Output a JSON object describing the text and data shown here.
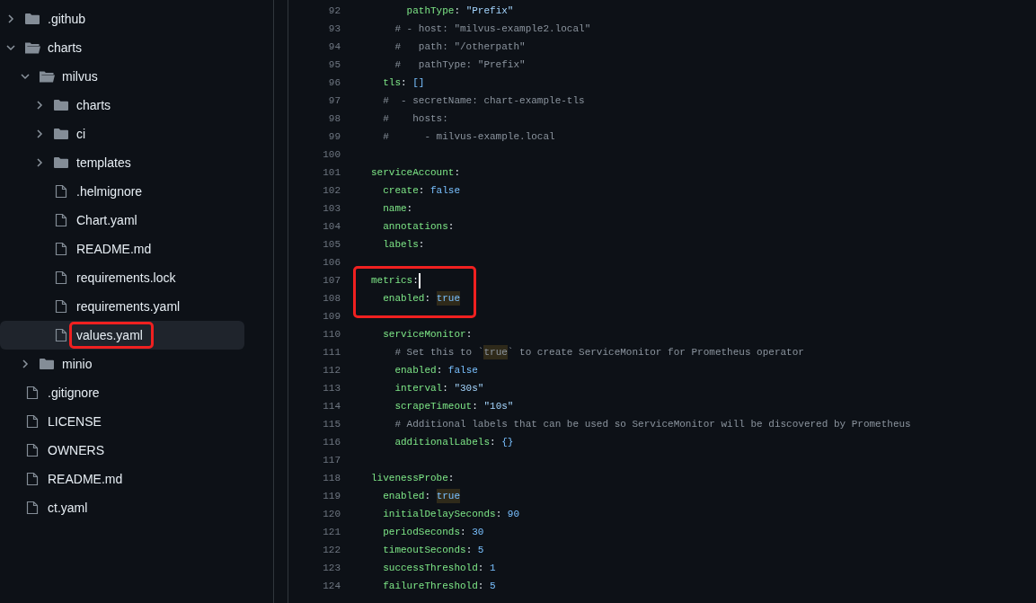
{
  "file_tree": [
    {
      "kind": "folder",
      "label": ".github",
      "expanded": false,
      "selected": false,
      "marked": false
    },
    {
      "kind": "folder",
      "label": "charts",
      "expanded": true,
      "selected": false,
      "marked": false,
      "children": [
        {
          "kind": "folder",
          "label": "milvus",
          "expanded": true,
          "selected": false,
          "marked": false,
          "children": [
            {
              "kind": "folder",
              "label": "charts",
              "expanded": false,
              "selected": false,
              "marked": false
            },
            {
              "kind": "folder",
              "label": "ci",
              "expanded": false,
              "selected": false,
              "marked": false
            },
            {
              "kind": "folder",
              "label": "templates",
              "expanded": false,
              "selected": false,
              "marked": false
            },
            {
              "kind": "file",
              "label": ".helmignore",
              "selected": false,
              "marked": false
            },
            {
              "kind": "file",
              "label": "Chart.yaml",
              "selected": false,
              "marked": false
            },
            {
              "kind": "file",
              "label": "README.md",
              "selected": false,
              "marked": false
            },
            {
              "kind": "file",
              "label": "requirements.lock",
              "selected": false,
              "marked": false
            },
            {
              "kind": "file",
              "label": "requirements.yaml",
              "selected": false,
              "marked": false
            },
            {
              "kind": "file",
              "label": "values.yaml",
              "selected": true,
              "marked": true
            }
          ]
        },
        {
          "kind": "folder",
          "label": "minio",
          "expanded": false,
          "selected": false,
          "marked": false
        }
      ]
    },
    {
      "kind": "file",
      "label": ".gitignore",
      "selected": false,
      "marked": false
    },
    {
      "kind": "file",
      "label": "LICENSE",
      "selected": false,
      "marked": false
    },
    {
      "kind": "file",
      "label": "OWNERS",
      "selected": false,
      "marked": false
    },
    {
      "kind": "file",
      "label": "README.md",
      "selected": false,
      "marked": false
    },
    {
      "kind": "file",
      "label": "ct.yaml",
      "selected": false,
      "marked": false
    }
  ],
  "code": {
    "lines": [
      {
        "n": "92",
        "marked": false,
        "cursor": false,
        "tokens": [
          {
            "kind": "key",
            "text": "      pathType"
          },
          {
            "kind": "punct",
            "text": ": "
          },
          {
            "kind": "str",
            "text": "\"Prefix\""
          }
        ]
      },
      {
        "n": "93",
        "marked": false,
        "cursor": false,
        "tokens": [
          {
            "kind": "comment",
            "text": "    # - host: \"milvus-example2.local\""
          }
        ]
      },
      {
        "n": "94",
        "marked": false,
        "cursor": false,
        "tokens": [
          {
            "kind": "comment",
            "text": "    #   path: \"/otherpath\""
          }
        ]
      },
      {
        "n": "95",
        "marked": false,
        "cursor": false,
        "tokens": [
          {
            "kind": "comment",
            "text": "    #   pathType: \"Prefix\""
          }
        ]
      },
      {
        "n": "96",
        "marked": false,
        "cursor": false,
        "tokens": [
          {
            "kind": "key",
            "text": "  tls"
          },
          {
            "kind": "punct",
            "text": ": "
          },
          {
            "kind": "value",
            "text": "[]"
          }
        ]
      },
      {
        "n": "97",
        "marked": false,
        "cursor": false,
        "tokens": [
          {
            "kind": "comment",
            "text": "  #  - secretName: chart-example-tls"
          }
        ]
      },
      {
        "n": "98",
        "marked": false,
        "cursor": false,
        "tokens": [
          {
            "kind": "comment",
            "text": "  #    hosts:"
          }
        ]
      },
      {
        "n": "99",
        "marked": false,
        "cursor": false,
        "tokens": [
          {
            "kind": "comment",
            "text": "  #      - milvus-example.local"
          }
        ]
      },
      {
        "n": "100",
        "marked": false,
        "cursor": false
      },
      {
        "n": "101",
        "marked": false,
        "cursor": false,
        "tokens": [
          {
            "kind": "key",
            "text": "serviceAccount"
          },
          {
            "kind": "punct",
            "text": ":"
          }
        ]
      },
      {
        "n": "102",
        "marked": false,
        "cursor": false,
        "tokens": [
          {
            "kind": "key",
            "text": "  create"
          },
          {
            "kind": "punct",
            "text": ": "
          },
          {
            "kind": "value",
            "text": "false"
          }
        ]
      },
      {
        "n": "103",
        "marked": false,
        "cursor": false,
        "tokens": [
          {
            "kind": "key",
            "text": "  name"
          },
          {
            "kind": "punct",
            "text": ":"
          }
        ]
      },
      {
        "n": "104",
        "marked": false,
        "cursor": false,
        "tokens": [
          {
            "kind": "key",
            "text": "  annotations"
          },
          {
            "kind": "punct",
            "text": ":"
          }
        ]
      },
      {
        "n": "105",
        "marked": false,
        "cursor": false,
        "tokens": [
          {
            "kind": "key",
            "text": "  labels"
          },
          {
            "kind": "punct",
            "text": ":"
          }
        ]
      },
      {
        "n": "106",
        "marked": false,
        "cursor": false
      },
      {
        "n": "107",
        "marked": true,
        "cursor": true,
        "tokens": [
          {
            "kind": "key",
            "text": "metrics"
          },
          {
            "kind": "punct",
            "text": ":"
          }
        ]
      },
      {
        "n": "108",
        "marked": true,
        "cursor": false,
        "tokens": [
          {
            "kind": "key",
            "text": "  enabled"
          },
          {
            "kind": "punct",
            "text": ": "
          },
          {
            "kind": "match",
            "text": "true"
          }
        ]
      },
      {
        "n": "109",
        "marked": false,
        "cursor": false
      },
      {
        "n": "110",
        "marked": false,
        "cursor": false,
        "tokens": [
          {
            "kind": "key",
            "text": "  serviceMonitor"
          },
          {
            "kind": "punct",
            "text": ":"
          }
        ]
      },
      {
        "n": "111",
        "marked": false,
        "cursor": false,
        "tokens": [
          {
            "kind": "comment",
            "text": "    # Set this to `"
          },
          {
            "kind": "comment-match",
            "text": "true"
          },
          {
            "kind": "comment",
            "text": "` to create ServiceMonitor for Prometheus operator"
          }
        ]
      },
      {
        "n": "112",
        "marked": false,
        "cursor": false,
        "tokens": [
          {
            "kind": "key",
            "text": "    enabled"
          },
          {
            "kind": "punct",
            "text": ": "
          },
          {
            "kind": "value",
            "text": "false"
          }
        ]
      },
      {
        "n": "113",
        "marked": false,
        "cursor": false,
        "tokens": [
          {
            "kind": "key",
            "text": "    interval"
          },
          {
            "kind": "punct",
            "text": ": "
          },
          {
            "kind": "str",
            "text": "\"30s\""
          }
        ]
      },
      {
        "n": "114",
        "marked": false,
        "cursor": false,
        "tokens": [
          {
            "kind": "key",
            "text": "    scrapeTimeout"
          },
          {
            "kind": "punct",
            "text": ": "
          },
          {
            "kind": "str",
            "text": "\"10s\""
          }
        ]
      },
      {
        "n": "115",
        "marked": false,
        "cursor": false,
        "tokens": [
          {
            "kind": "comment",
            "text": "    # Additional labels that can be used so ServiceMonitor will be discovered by Prometheus"
          }
        ]
      },
      {
        "n": "116",
        "marked": false,
        "cursor": false,
        "tokens": [
          {
            "kind": "key",
            "text": "    additionalLabels"
          },
          {
            "kind": "punct",
            "text": ": "
          },
          {
            "kind": "value",
            "text": "{}"
          }
        ]
      },
      {
        "n": "117",
        "marked": false,
        "cursor": false
      },
      {
        "n": "118",
        "marked": false,
        "cursor": false,
        "tokens": [
          {
            "kind": "key",
            "text": "livenessProbe"
          },
          {
            "kind": "punct",
            "text": ":"
          }
        ]
      },
      {
        "n": "119",
        "marked": false,
        "cursor": false,
        "tokens": [
          {
            "kind": "key",
            "text": "  enabled"
          },
          {
            "kind": "punct",
            "text": ": "
          },
          {
            "kind": "match",
            "text": "true"
          }
        ]
      },
      {
        "n": "120",
        "marked": false,
        "cursor": false,
        "tokens": [
          {
            "kind": "key",
            "text": "  initialDelaySeconds"
          },
          {
            "kind": "punct",
            "text": ": "
          },
          {
            "kind": "value",
            "text": "90"
          }
        ]
      },
      {
        "n": "121",
        "marked": false,
        "cursor": false,
        "tokens": [
          {
            "kind": "key",
            "text": "  periodSeconds"
          },
          {
            "kind": "punct",
            "text": ": "
          },
          {
            "kind": "value",
            "text": "30"
          }
        ]
      },
      {
        "n": "122",
        "marked": false,
        "cursor": false,
        "tokens": [
          {
            "kind": "key",
            "text": "  timeoutSeconds"
          },
          {
            "kind": "punct",
            "text": ": "
          },
          {
            "kind": "value",
            "text": "5"
          }
        ]
      },
      {
        "n": "123",
        "marked": false,
        "cursor": false,
        "tokens": [
          {
            "kind": "key",
            "text": "  successThreshold"
          },
          {
            "kind": "punct",
            "text": ": "
          },
          {
            "kind": "value",
            "text": "1"
          }
        ]
      },
      {
        "n": "124",
        "marked": false,
        "cursor": false,
        "tokens": [
          {
            "kind": "key",
            "text": "  failureThreshold"
          },
          {
            "kind": "punct",
            "text": ": "
          },
          {
            "kind": "value",
            "text": "5"
          }
        ]
      }
    ]
  }
}
